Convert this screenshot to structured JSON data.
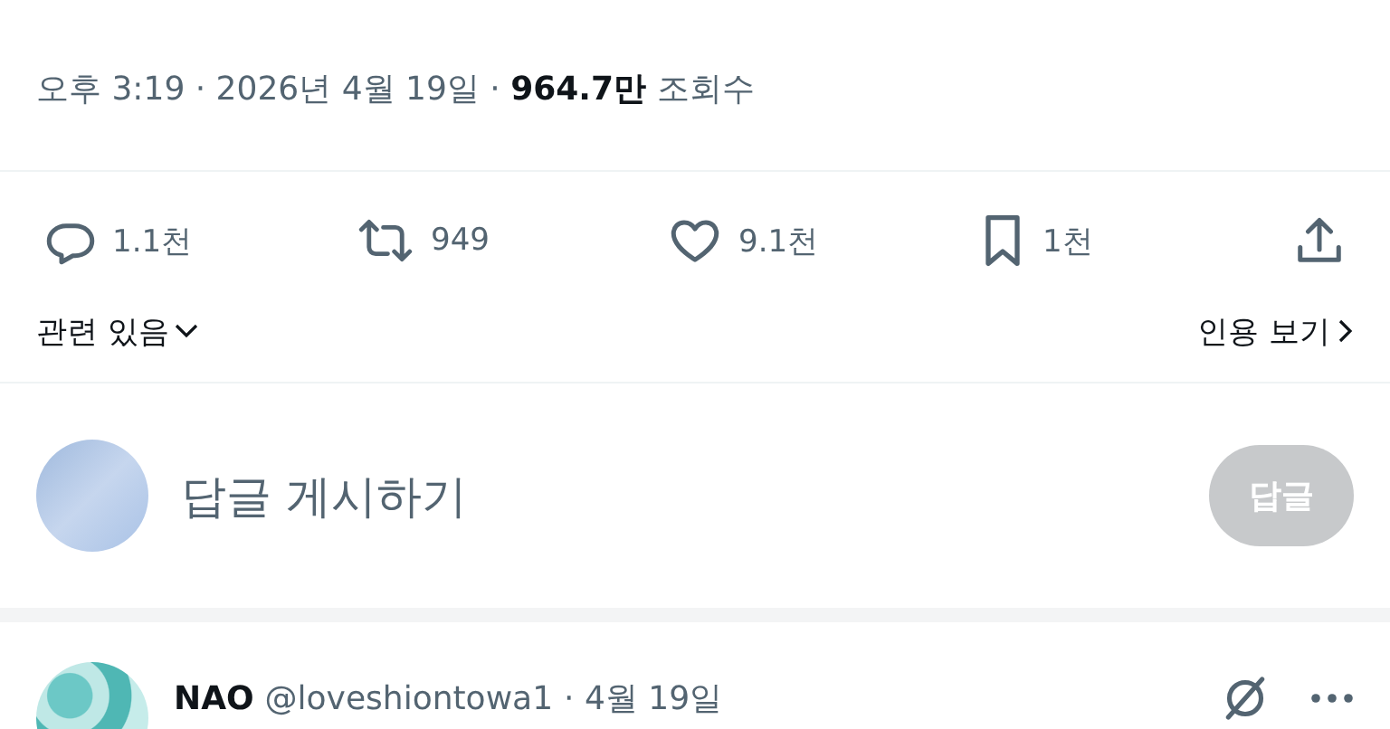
{
  "timestamp": "오후 3:19 · 2026년 4월 19일 · **964.7만** 조회수",
  "actions": [
    {
      "kind": "reply",
      "count": "1.1천"
    },
    {
      "kind": "repost",
      "count": "949"
    },
    {
      "kind": "like",
      "count": "9.1천"
    },
    {
      "kind": "bookmark",
      "count": "1천"
    },
    {
      "kind": "share"
    }
  ],
  "related": {
    "label": "관련 있음"
  },
  "quotes": {
    "label": "인용 보기"
  },
  "composer": {
    "placeholder": "답글 게시하기",
    "button": "답글",
    "button_disabled": true
  },
  "reply_tweet": {
    "name": "NAO",
    "handle": "@loveshiontowa1",
    "date": "· 4월 19일"
  }
}
